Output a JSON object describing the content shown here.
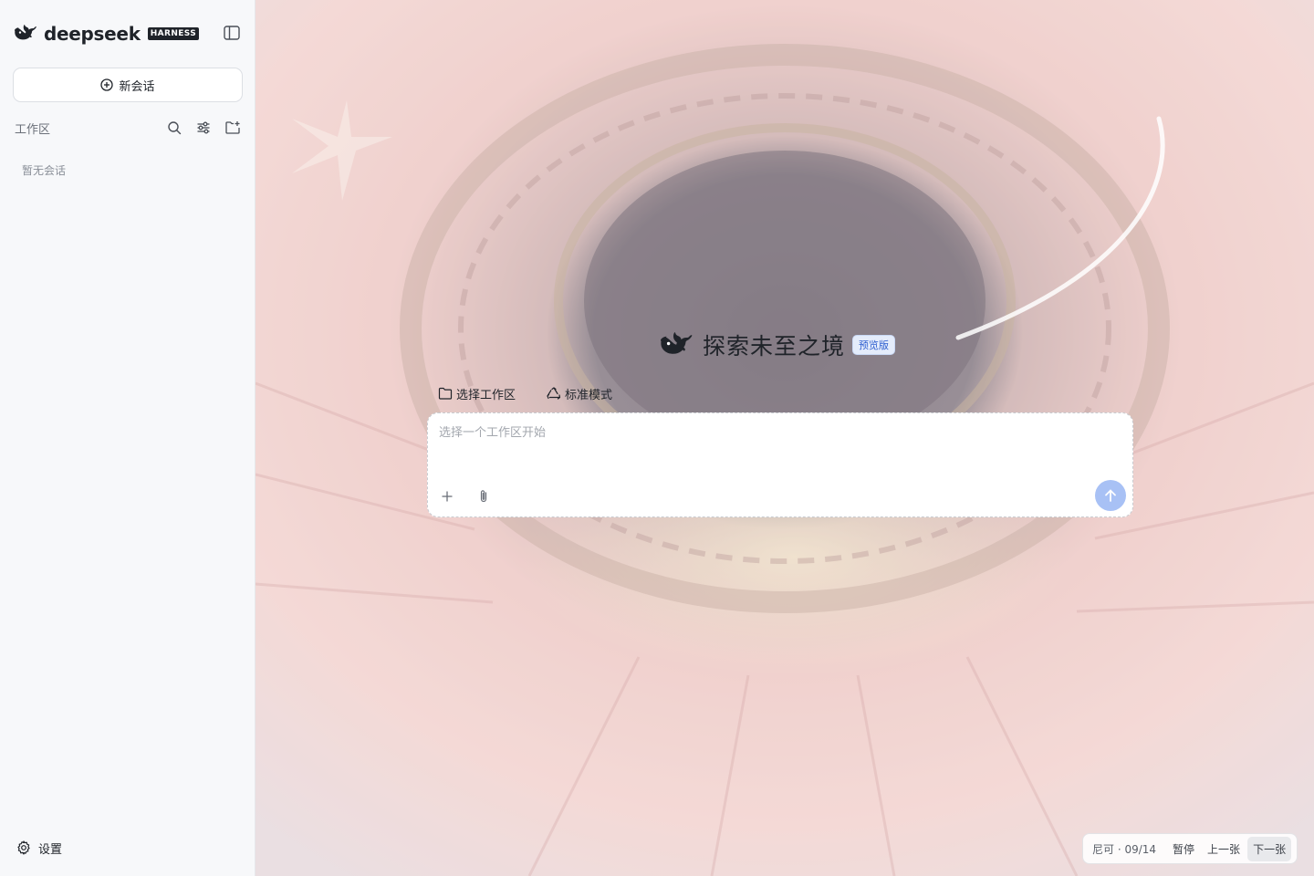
{
  "brand": {
    "name": "deepseek",
    "badge": "HARNESS"
  },
  "sidebar": {
    "new_chat_label": "新会话",
    "workspace_title": "工作区",
    "empty_text": "暂无会话",
    "settings_label": "设置",
    "icons": [
      "whale-logo-icon",
      "sidebar-toggle-icon",
      "plus-circle-icon",
      "search-icon",
      "sliders-icon",
      "new-folder-icon",
      "gear-icon"
    ]
  },
  "hero": {
    "title": "探索未至之境",
    "badge": "预览版"
  },
  "toolbar": {
    "workspace_select_label": "选择工作区",
    "mode_label": "标准模式"
  },
  "composer": {
    "placeholder": "选择一个工作区开始",
    "value": ""
  },
  "slideshow": {
    "counter": "尼可 · 09/14",
    "pause_label": "暂停",
    "prev_label": "上一张",
    "next_label": "下一张"
  },
  "colors": {
    "accent": "#a8c1f5",
    "badge_bg": "#e4ecfb",
    "badge_text": "#2f5fd0",
    "sidebar_bg": "#f7f8fa"
  }
}
